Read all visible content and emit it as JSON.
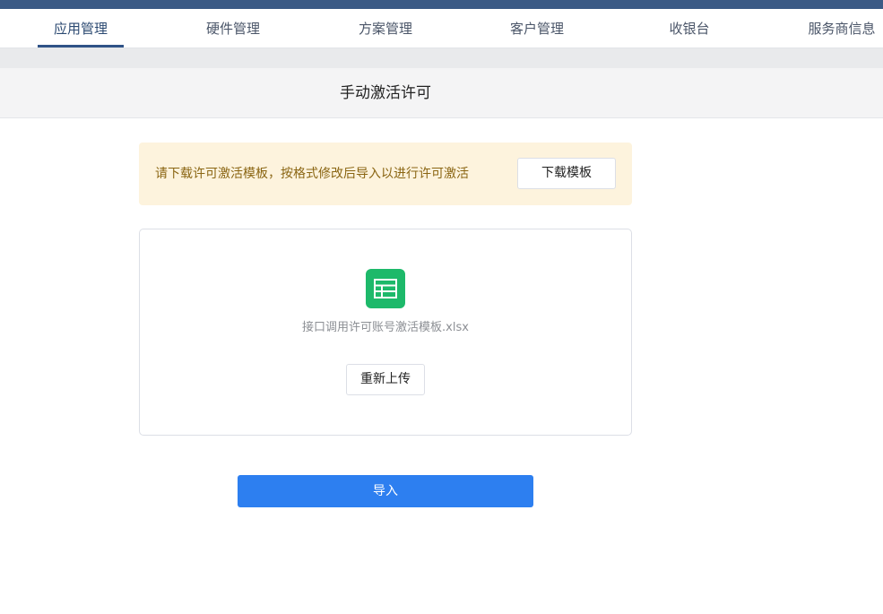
{
  "nav": {
    "tabs": [
      {
        "label": "应用管理",
        "active": true
      },
      {
        "label": "硬件管理",
        "active": false
      },
      {
        "label": "方案管理",
        "active": false
      },
      {
        "label": "客户管理",
        "active": false
      },
      {
        "label": "收银台",
        "active": false
      },
      {
        "label": "服务商信息",
        "active": false
      }
    ]
  },
  "page": {
    "title": "手动激活许可"
  },
  "notice": {
    "text": "请下载许可激活模板，按格式修改后导入以进行许可激活",
    "download_label": "下载模板"
  },
  "upload": {
    "icon": "spreadsheet-file-icon",
    "file_name": "接口调用许可账号激活模板.xlsx",
    "reupload_label": "重新上传"
  },
  "import_label": "导入",
  "colors": {
    "nav_active": "#2f5387",
    "notice_bg": "#fdf3dd",
    "notice_text": "#8a6512",
    "file_icon": "#1db96a",
    "primary": "#2d7ff0"
  }
}
